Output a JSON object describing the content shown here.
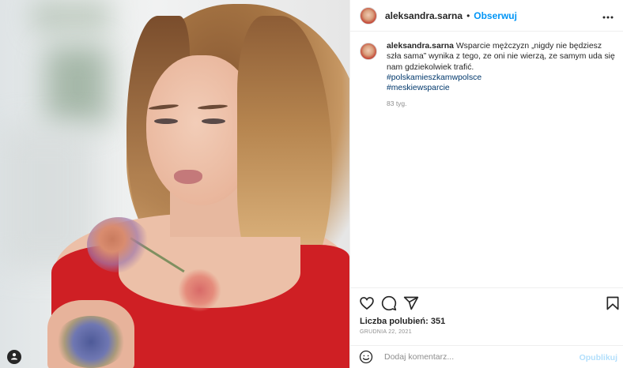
{
  "post": {
    "username": "aleksandra.sarna",
    "separator": "•",
    "follow_label": "Obserwuj",
    "more_icon": "more-horizontal-icon",
    "caption": {
      "text": "Wsparcie mężczyzn „nigdy nie będziesz szła sama” wynika z tego, ze oni nie wierzą, ze samym uda się nam gdziekolwiek trafić.",
      "hashtags": [
        "#polskamieszkamwpolsce",
        "#meskiewsparcie"
      ],
      "time_ago": "83 tyg."
    },
    "actions": {
      "like_icon": "heart-icon",
      "comment_icon": "comment-icon",
      "share_icon": "paper-plane-icon",
      "save_icon": "bookmark-icon"
    },
    "likes_label": "Liczba polubień: 351",
    "date": "GRUDNIA 22, 2021",
    "comment": {
      "emoji_icon": "smiley-icon",
      "placeholder": "Dodaj komentarz...",
      "publish_label": "Opublikuj"
    }
  },
  "colors": {
    "accent": "#0095f6",
    "hashtag": "#00376b",
    "publish_disabled": "#b2dffc",
    "dress_red": "#cf1f24"
  }
}
